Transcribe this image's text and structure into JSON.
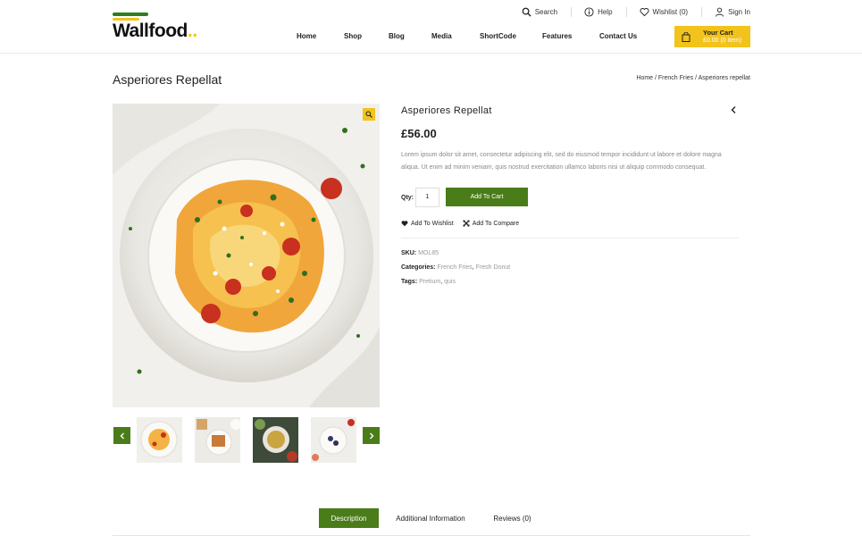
{
  "brand": {
    "name": "Wallfood",
    "accent": "#f2c31b",
    "green": "#4a7c19"
  },
  "toplinks": {
    "search": "Search",
    "help": "Help",
    "wishlist": "Wishlist (0)",
    "signin": "Sign In"
  },
  "nav": [
    "Home",
    "Shop",
    "Blog",
    "Media",
    "ShortCode",
    "Features",
    "Contact Us"
  ],
  "cart": {
    "title": "Your Cart",
    "summary": "£0.00 (0 item)"
  },
  "page": {
    "title": "Asperiores Repellat",
    "breadcrumb": "Home / French Fries / Asperiores repellat"
  },
  "product": {
    "title": "Asperiores Repellat",
    "price": "£56.00",
    "description": "Lorem ipsum dolor sit amet, consectetur adipiscing elit, sed do eiusmod tempor incididunt ut labore et dolore magna aliqua. Ut enim ad minim veniam, quis nostrud exercitation ullamco laboris nisi ut aliquip commodo consequat.",
    "qty_label": "Qty:",
    "qty_value": "1",
    "add_to_cart": "Add To Cart",
    "add_to_wishlist": "Add To Wishlist",
    "add_to_compare": "Add To Compare",
    "sku_label": "SKU:",
    "sku": "MOL85",
    "categories_label": "Categories:",
    "categories": [
      "French Fries",
      "Fresh Donut"
    ],
    "tags_label": "Tags:",
    "tags": [
      "Pretium",
      "quis"
    ]
  },
  "tabs": [
    "Description",
    "Additional Information",
    "Reviews (0)"
  ]
}
